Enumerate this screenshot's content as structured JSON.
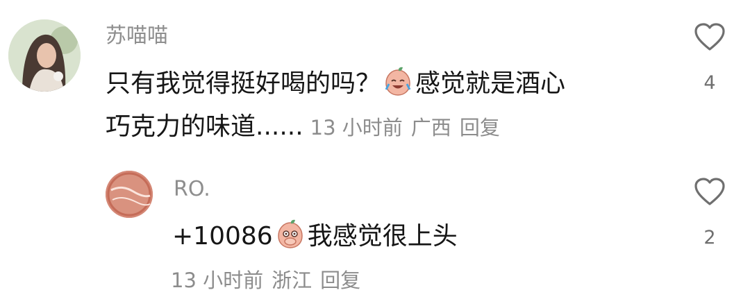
{
  "comments": [
    {
      "username": "苏喵喵",
      "text_line1_before_emoji": "只有我觉得挺好喝的吗？",
      "text_line1_after_emoji": "感觉就是酒心",
      "text_line2": "巧克力的味道......",
      "emoji": "crying-laughing-peach-emoji",
      "time": "13 小时前",
      "location": "广西",
      "reply_label": "回复",
      "likes": "4"
    },
    {
      "username": "RO.",
      "text_before_emoji": "+10086",
      "text_after_emoji": "我感觉很上头",
      "emoji": "covering-mouth-peach-emoji",
      "time": "13 小时前",
      "location": "浙江",
      "reply_label": "回复",
      "likes": "2"
    }
  ],
  "icons": {
    "like": "heart-outline-icon"
  },
  "colors": {
    "text": "#161616",
    "secondary": "#8c8c8c",
    "icon": "#6f6f6f"
  }
}
